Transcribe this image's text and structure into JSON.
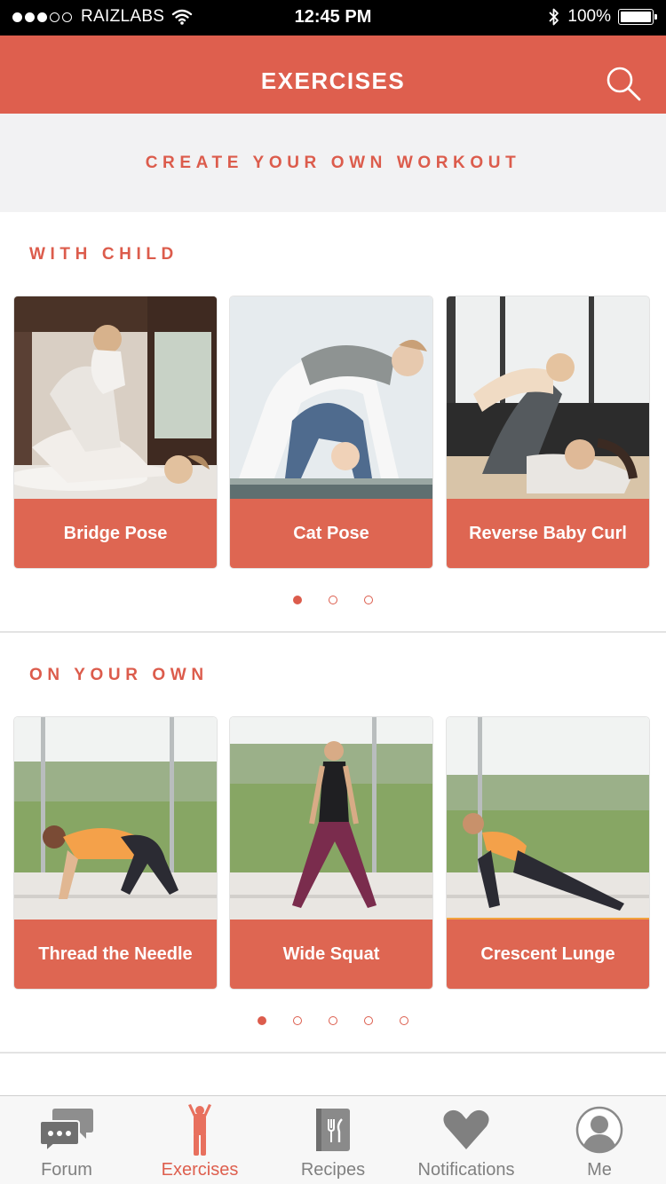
{
  "status_bar": {
    "carrier": "RAIZLABS",
    "time": "12:45 PM",
    "battery": "100%",
    "battery_level": 1.0
  },
  "nav": {
    "title": "EXERCISES",
    "search_icon": "search-icon"
  },
  "create_workout": {
    "label": "CREATE YOUR OWN WORKOUT"
  },
  "sections": [
    {
      "title": "WITH CHILD",
      "cards": [
        "Bridge Pose",
        "Cat Pose",
        "Reverse Baby Curl"
      ],
      "page_count": 3,
      "active_page": 1
    },
    {
      "title": "ON YOUR OWN",
      "cards": [
        "Thread the Needle",
        "Wide Squat",
        "Crescent Lunge"
      ],
      "page_count": 5,
      "active_page": 1
    }
  ],
  "tabs": [
    {
      "label": "Forum",
      "icon": "chat-bubbles-icon",
      "active": false
    },
    {
      "label": "Exercises",
      "icon": "person-exercise-icon",
      "active": true
    },
    {
      "label": "Recipes",
      "icon": "recipe-book-icon",
      "active": false
    },
    {
      "label": "Notifications",
      "icon": "heart-icon",
      "active": false
    },
    {
      "label": "Me",
      "icon": "profile-avatar-icon",
      "active": false
    }
  ],
  "colors": {
    "brand": "#de5f4e",
    "card_label": "#de6652",
    "tab_inactive": "#808080",
    "banner_bg": "#f2f2f3"
  }
}
